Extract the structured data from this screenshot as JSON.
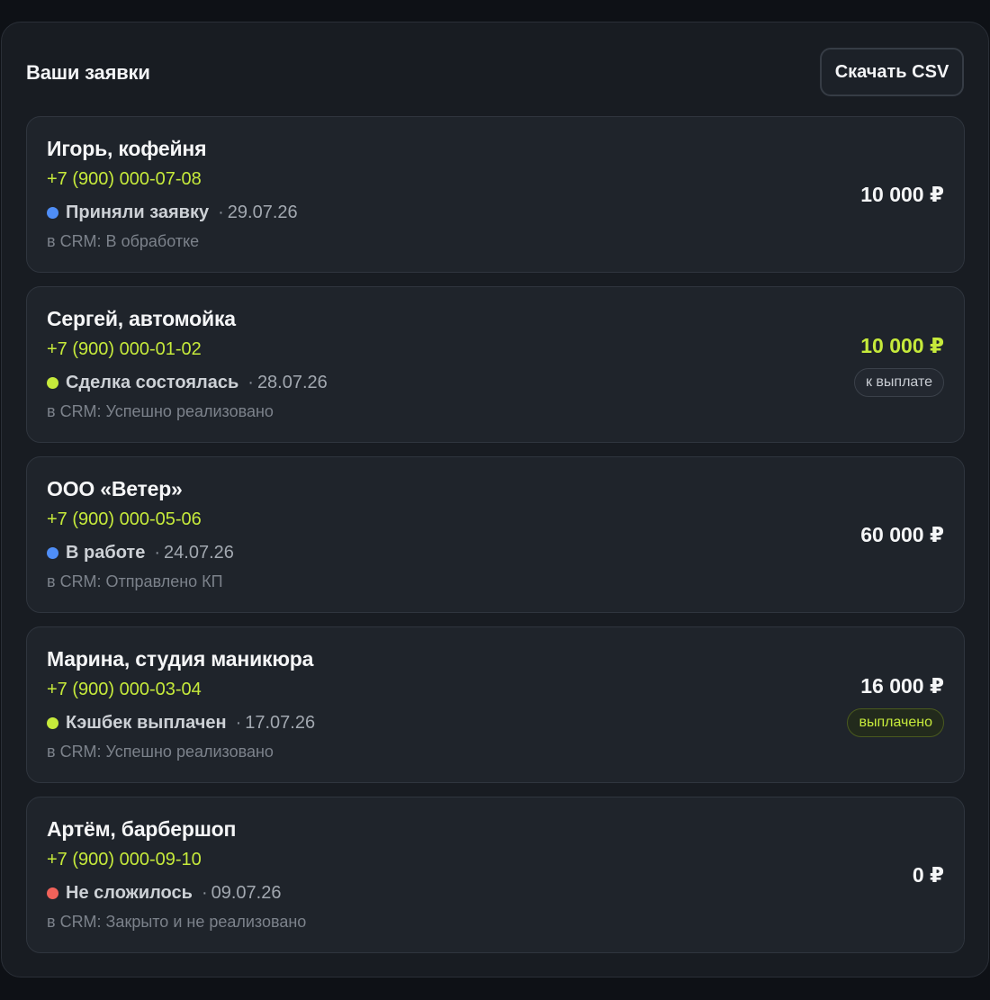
{
  "header": {
    "title": "Ваши заявки",
    "csv_button": "Скачать CSV"
  },
  "colors": {
    "accent": "#c6ea3b",
    "status_blue": "#4f8ef7",
    "status_green": "#c6ea3b",
    "status_red": "#f0625a"
  },
  "requests": [
    {
      "name": "Игорь, кофейня",
      "phone": "+7 (900) 000-07-08",
      "status": "Приняли заявку",
      "status_color": "blue",
      "date": "29.07.26",
      "crm": "в CRM: В обработке",
      "amount": "10 000 ₽",
      "badge": ""
    },
    {
      "name": "Сергей, автомойка",
      "phone": "+7 (900) 000-01-02",
      "status": "Сделка состоялась",
      "status_color": "green",
      "date": "28.07.26",
      "crm": "в CRM: Успешно реализовано",
      "amount": "10 000 ₽",
      "badge": "к выплате"
    },
    {
      "name": "ООО «Ветер»",
      "phone": "+7 (900) 000-05-06",
      "status": "В работе",
      "status_color": "blue",
      "date": "24.07.26",
      "crm": "в CRM: Отправлено КП",
      "amount": "60 000 ₽",
      "badge": ""
    },
    {
      "name": "Марина, студия маникюра",
      "phone": "+7 (900) 000-03-04",
      "status": "Кэшбек выплачен",
      "status_color": "green",
      "date": "17.07.26",
      "crm": "в CRM: Успешно реализовано",
      "amount": "16 000 ₽",
      "badge": "выплачено"
    },
    {
      "name": "Артём, барбершоп",
      "phone": "+7 (900) 000-09-10",
      "status": "Не сложилось",
      "status_color": "red",
      "date": "09.07.26",
      "crm": "в CRM: Закрыто и не реализовано",
      "amount": "0 ₽",
      "badge": ""
    }
  ]
}
